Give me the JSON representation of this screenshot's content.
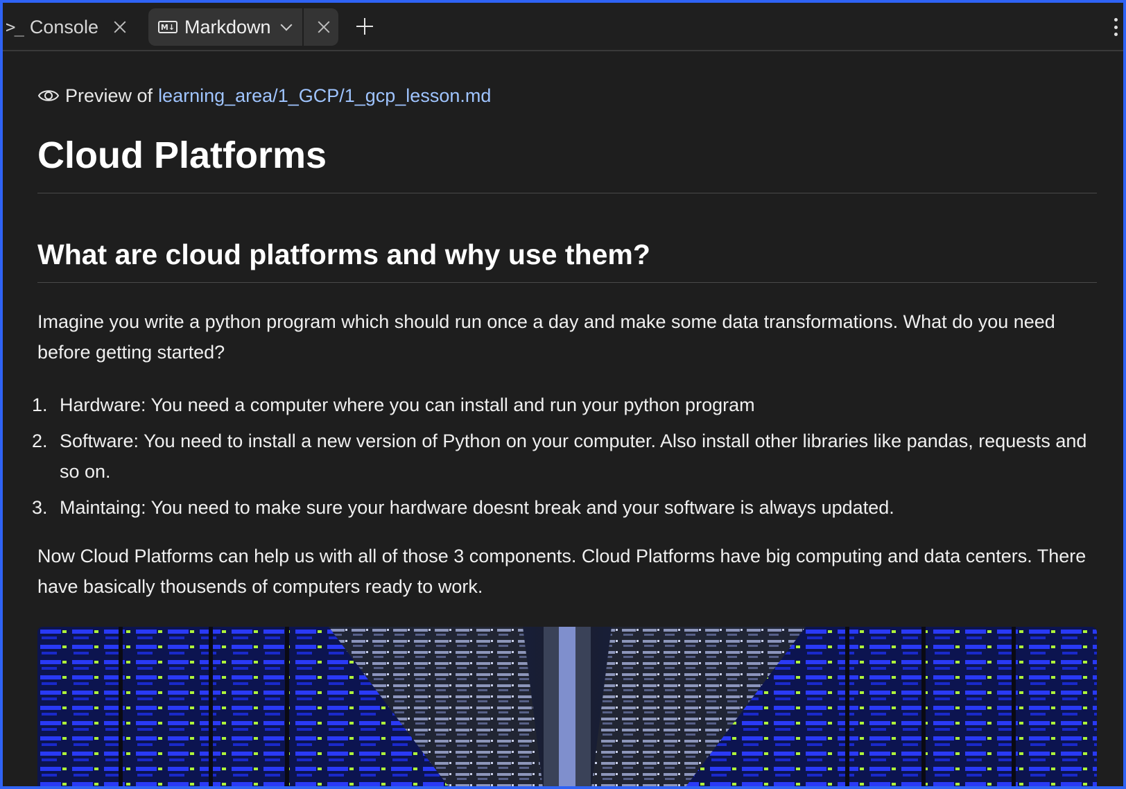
{
  "tabs": [
    {
      "label": "Console",
      "icon": "terminal-prompt-icon"
    },
    {
      "label": "Markdown",
      "icon": "markdown-icon",
      "active": true
    }
  ],
  "markdown_icon_text": "M↓",
  "console_prompt_glyph": ">_",
  "preview": {
    "prefix": "Preview of",
    "path": "learning_area/1_GCP/1_gcp_lesson.md"
  },
  "document": {
    "title": "Cloud Platforms",
    "section_heading": "What are cloud platforms and why use them?",
    "intro": "Imagine you write a python program which should run once a day and make some data transformations. What do you need before getting started?",
    "list": [
      {
        "num": "1.",
        "text": "Hardware: You need a computer where you can install and run your python program"
      },
      {
        "num": "2.",
        "text": "Software: You need to install a new version of Python on your computer. Also install other libraries like pandas, requests and so on."
      },
      {
        "num": "3.",
        "text": "Maintaing: You need to make sure your hardware doesnt break and your software is always updated."
      }
    ],
    "closing": "Now Cloud Platforms can help us with all of those 3 components. Cloud Platforms have big computing and data centers. There have basically thousends of computers ready to work."
  },
  "colors": {
    "frame_border": "#2f63f5",
    "background": "#1e1e1e",
    "link": "#9fc4ff"
  }
}
